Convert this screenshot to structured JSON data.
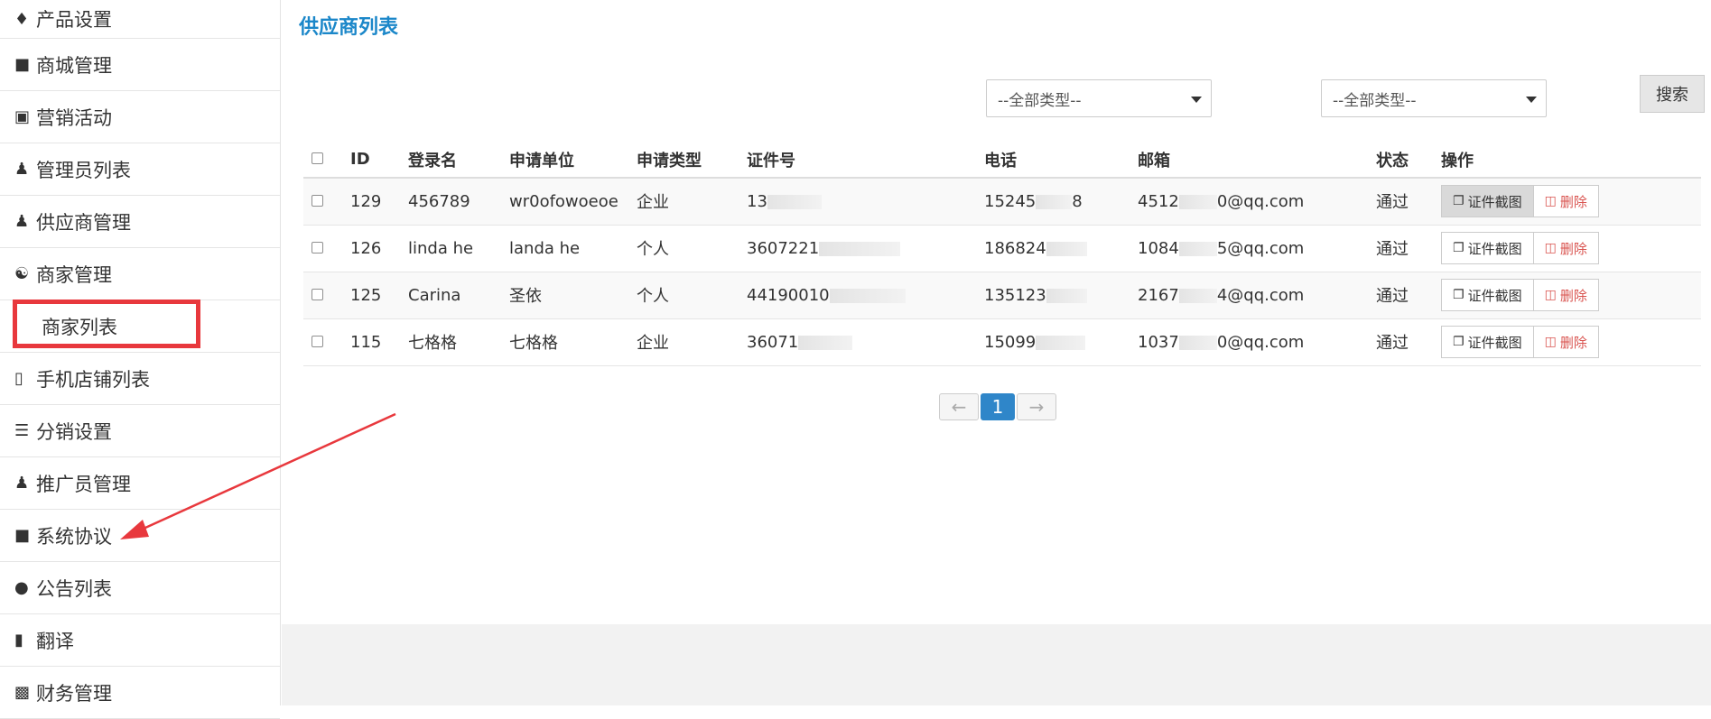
{
  "sidebar": {
    "items": [
      {
        "label": "产品设置",
        "icon": "tag-icon"
      },
      {
        "label": "商城管理",
        "icon": "bag-icon"
      },
      {
        "label": "营销活动",
        "icon": "gift-icon"
      },
      {
        "label": "管理员列表",
        "icon": "user-secret-icon"
      },
      {
        "label": "供应商管理",
        "icon": "user-tie-icon"
      },
      {
        "label": "商家管理",
        "icon": "users-icon"
      },
      {
        "label": "商家列表",
        "icon": ""
      },
      {
        "label": "手机店铺列表",
        "icon": "mobile-icon"
      },
      {
        "label": "分销设置",
        "icon": "bars-icon"
      },
      {
        "label": "推广员管理",
        "icon": "user-tie-icon"
      },
      {
        "label": "系统协议",
        "icon": "bag-icon"
      },
      {
        "label": "公告列表",
        "icon": "comments-icon"
      },
      {
        "label": "翻译",
        "icon": "book-icon"
      },
      {
        "label": "财务管理",
        "icon": "money-icon"
      }
    ]
  },
  "page": {
    "title": "供应商列表"
  },
  "filters": {
    "type1": "--全部类型--",
    "type2": "--全部类型--",
    "search_label": "搜索"
  },
  "table": {
    "headers": [
      "ID",
      "登录名",
      "申请单位",
      "申请类型",
      "证件号",
      "电话",
      "邮箱",
      "状态",
      "操作"
    ],
    "rows": [
      {
        "id": "129",
        "login": "456789",
        "unit": "wr0ofowoeoe",
        "type": "企业",
        "cert": "13",
        "phone": "15245",
        "phone_tail": "8",
        "email_pre": "4512",
        "email_suf": "0@qq.com",
        "status": "通过"
      },
      {
        "id": "126",
        "login": "linda he",
        "unit": "landa he",
        "type": "个人",
        "cert": "3607221",
        "phone": "186824",
        "phone_tail": "",
        "email_pre": "1084",
        "email_suf": "5@qq.com",
        "status": "通过"
      },
      {
        "id": "125",
        "login": "Carina",
        "unit": "圣依",
        "type": "个人",
        "cert": "44190010",
        "phone": "135123",
        "phone_tail": "",
        "email_pre": "2167",
        "email_suf": "4@qq.com",
        "status": "通过"
      },
      {
        "id": "115",
        "login": "七格格",
        "unit": "七格格",
        "type": "企业",
        "cert": "36071",
        "phone": "15099",
        "phone_tail": "",
        "email_pre": "1037",
        "email_suf": "0@qq.com",
        "status": "通过"
      }
    ],
    "cert_btn": "证件截图",
    "del_btn": "删除"
  },
  "pager": {
    "prev": "←",
    "current": "1",
    "next": "→"
  },
  "colors": {
    "title": "#1b87c9",
    "highlight": "#e8383d",
    "danger": "#d9534f",
    "active_page": "#2f86c9"
  }
}
